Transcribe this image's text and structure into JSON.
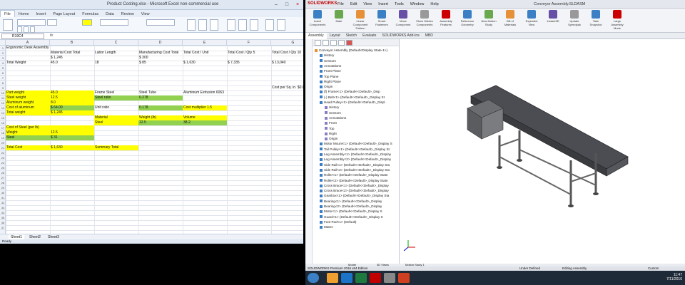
{
  "excel": {
    "title": "Product Costing.xlsx - Microsoft Excel non-commercial use",
    "tabs": [
      "File",
      "Home",
      "Insert",
      "Page Layout",
      "Formulas",
      "Data",
      "Review",
      "View"
    ],
    "name_box": "R19C4",
    "fx": "fx",
    "columns": [
      "",
      "A",
      "B",
      "C",
      "D",
      "E",
      "F",
      "G",
      "H"
    ],
    "rows": [
      "1",
      "2",
      "3",
      "4",
      "5",
      "6",
      "7",
      "8",
      "9",
      "10",
      "11",
      "12",
      "13",
      "14",
      "15",
      "16",
      "17",
      "18",
      "19",
      "20",
      "21",
      "22",
      "23",
      "24",
      "25",
      "26",
      "27",
      "28",
      "29",
      "30",
      "31",
      "32",
      "33",
      "34",
      "35",
      "36",
      "37"
    ],
    "cells": [
      {
        "r": 1,
        "c": 0,
        "t": "Ergonomic Desk Assembly",
        "fill": ""
      },
      {
        "r": 2,
        "c": 1,
        "t": "Material Cost Total",
        "fill": ""
      },
      {
        "r": 2,
        "c": 2,
        "t": "Labor Length",
        "fill": ""
      },
      {
        "r": 2,
        "c": 3,
        "t": "Manufacturing Cost Total",
        "fill": ""
      },
      {
        "r": 2,
        "c": 4,
        "t": "Total Cost / Unit",
        "fill": ""
      },
      {
        "r": 2,
        "c": 5,
        "t": "Total Cost / Qty 5",
        "fill": ""
      },
      {
        "r": 2,
        "c": 6,
        "t": "Total Cost / Qty 10",
        "fill": ""
      },
      {
        "r": 3,
        "c": 1,
        "t": "$ 1,245",
        "fill": ""
      },
      {
        "r": 3,
        "c": 3,
        "t": "$ 300",
        "fill": ""
      },
      {
        "r": 4,
        "c": 0,
        "t": "Total Weight",
        "fill": ""
      },
      {
        "r": 4,
        "c": 1,
        "t": "45.0",
        "fill": ""
      },
      {
        "r": 4,
        "c": 2,
        "t": "18",
        "fill": ""
      },
      {
        "r": 4,
        "c": 3,
        "t": "$ 85",
        "fill": ""
      },
      {
        "r": 4,
        "c": 4,
        "t": "$ 1,630",
        "fill": ""
      },
      {
        "r": 4,
        "c": 5,
        "t": "$ 7,335",
        "fill": ""
      },
      {
        "r": 4,
        "c": 6,
        "t": "$ 13,040",
        "fill": ""
      },
      {
        "r": 9,
        "c": 6,
        "t": "Cost per Sq. in. $0.05",
        "fill": ""
      },
      {
        "r": 10,
        "c": 0,
        "t": "Part weight",
        "fill": "y",
        "w": 124
      },
      {
        "r": 10,
        "c": 1,
        "t": "45.0",
        "fill": "y"
      },
      {
        "r": 10,
        "c": 2,
        "t": "Frame Steel",
        "fill": ""
      },
      {
        "r": 10,
        "c": 3,
        "t": "Steel Tube",
        "fill": ""
      },
      {
        "r": 10,
        "c": 4,
        "t": "Aluminum Extrusion 6063",
        "fill": ""
      },
      {
        "r": 11,
        "c": 0,
        "t": "Steel weight",
        "fill": "y",
        "w": 124
      },
      {
        "r": 11,
        "c": 1,
        "t": "12.5",
        "fill": "y"
      },
      {
        "r": 11,
        "c": 2,
        "t": "Steel ratio",
        "fill": "g"
      },
      {
        "r": 11,
        "c": 3,
        "t": "0.278",
        "fill": "g"
      },
      {
        "r": 12,
        "c": 0,
        "t": "Aluminum weight",
        "fill": "y",
        "w": 124
      },
      {
        "r": 12,
        "c": 1,
        "t": "8.0",
        "fill": "y"
      },
      {
        "r": 13,
        "c": 0,
        "t": "Cost of aluminum",
        "fill": "y",
        "w": 124
      },
      {
        "r": 13,
        "c": 1,
        "t": "$ 64.00",
        "fill": "g"
      },
      {
        "r": 13,
        "c": 2,
        "t": "Unit ratio",
        "fill": ""
      },
      {
        "r": 13,
        "c": 3,
        "t": "0.178",
        "fill": "g"
      },
      {
        "r": 13,
        "c": 4,
        "t": "Cost multiplier 1.5",
        "fill": "y"
      },
      {
        "r": 14,
        "c": 0,
        "t": "Total weight",
        "fill": "y",
        "w": 124
      },
      {
        "r": 14,
        "c": 1,
        "t": "$ 1,245",
        "fill": "y"
      },
      {
        "r": 15,
        "c": 2,
        "t": "Material",
        "fill": "y"
      },
      {
        "r": 15,
        "c": 3,
        "t": "Weight (lb)",
        "fill": "y"
      },
      {
        "r": 15,
        "c": 4,
        "t": "Volume",
        "fill": "y"
      },
      {
        "r": 16,
        "c": 2,
        "t": "Steel",
        "fill": "y"
      },
      {
        "r": 16,
        "c": 3,
        "t": "12.5",
        "fill": "g"
      },
      {
        "r": 16,
        "c": 4,
        "t": "38.2",
        "fill": "g"
      },
      {
        "r": 17,
        "c": 0,
        "t": "Cost of Steel (per lb)",
        "fill": "y",
        "w": 124
      },
      {
        "r": 18,
        "c": 0,
        "t": "Weight",
        "fill": "y",
        "w": 62
      },
      {
        "r": 18,
        "c": 1,
        "t": "12.5",
        "fill": "y"
      },
      {
        "r": 19,
        "c": 0,
        "t": "Steel",
        "fill": "g",
        "w": 62
      },
      {
        "r": 19,
        "c": 1,
        "t": "$ 31",
        "fill": "g"
      },
      {
        "r": 21,
        "c": 0,
        "t": "Total Cost",
        "fill": "y",
        "w": 124
      },
      {
        "r": 21,
        "c": 1,
        "t": "$ 1,630",
        "fill": "y"
      },
      {
        "r": 21,
        "c": 2,
        "t": "Summary Total",
        "fill": "y"
      }
    ],
    "sheets": [
      "Sheet1",
      "Sheet2",
      "Sheet3"
    ],
    "status": "Ready"
  },
  "solidworks": {
    "logo": "SOLIDWORKS",
    "menu": [
      "File",
      "Edit",
      "View",
      "Insert",
      "Tools",
      "Window",
      "Help"
    ],
    "doc_title": "Conveyor Assembly.SLDASM",
    "commands": [
      "Insert Components",
      "Mate",
      "Linear Component Pattern",
      "Smart Fasteners",
      "Move Component",
      "Show Hidden Components",
      "Assembly Features",
      "Reference Geometry",
      "New Motion Study",
      "Bill of Materials",
      "Exploded View",
      "Instant3D",
      "Update Speedpak",
      "Take Snapshot",
      "Large Assembly Mode"
    ],
    "tabs": [
      "Assembly",
      "Layout",
      "Sketch",
      "Evaluate",
      "SOLIDWORKS Add-Ins",
      "MBD"
    ],
    "tree": [
      {
        "lvl": 0,
        "t": "Conveyor Assembly (Default<Display State-1>)"
      },
      {
        "lvl": 1,
        "t": "History"
      },
      {
        "lvl": 1,
        "t": "Sensors"
      },
      {
        "lvl": 1,
        "t": "Annotations"
      },
      {
        "lvl": 1,
        "t": "Front Plane"
      },
      {
        "lvl": 1,
        "t": "Top Plane"
      },
      {
        "lvl": 1,
        "t": "Right Plane"
      },
      {
        "lvl": 1,
        "t": "Origin"
      },
      {
        "lvl": 1,
        "t": "(f) Frame<1> (Default<<Default>_Disp"
      },
      {
        "lvl": 1,
        "t": "(-) Belt<1> (Default<<Default>_Display St"
      },
      {
        "lvl": 1,
        "t": "Head Pulley<1> (Default<<Default>_Displ"
      },
      {
        "lvl": 2,
        "t": "History"
      },
      {
        "lvl": 2,
        "t": "Sensors"
      },
      {
        "lvl": 2,
        "t": "Annotations"
      },
      {
        "lvl": 2,
        "t": "Front"
      },
      {
        "lvl": 2,
        "t": "Top"
      },
      {
        "lvl": 2,
        "t": "Right"
      },
      {
        "lvl": 2,
        "t": "Origin"
      },
      {
        "lvl": 1,
        "t": "Motor Mount<1> (Default<<Default>_Display S"
      },
      {
        "lvl": 1,
        "t": "Tail Pulley<1> (Default<<Default>_Display St"
      },
      {
        "lvl": 1,
        "t": "Leg Assembly<1> (Default<<Default>_Display"
      },
      {
        "lvl": 1,
        "t": "Leg Assembly<2> (Default<<Default>_Display"
      },
      {
        "lvl": 1,
        "t": "Side Rail<1> (Default<<Default>_Display Sta"
      },
      {
        "lvl": 1,
        "t": "Side Rail<2> (Default<<Default>_Display Sta"
      },
      {
        "lvl": 1,
        "t": "Roller<1> (Default<<Default>_Display State"
      },
      {
        "lvl": 1,
        "t": "Roller<2> (Default<<Default>_Display State"
      },
      {
        "lvl": 1,
        "t": "Cross Brace<1> (Default<<Default>_Display"
      },
      {
        "lvl": 1,
        "t": "Cross Brace<2> (Default<<Default>_Display"
      },
      {
        "lvl": 1,
        "t": "Gearbox<1> (Default<<Default>_Display Sta"
      },
      {
        "lvl": 1,
        "t": "Bearing<1> (Default<<Default>_Display"
      },
      {
        "lvl": 1,
        "t": "Bearing<2> (Default<<Default>_Display"
      },
      {
        "lvl": 1,
        "t": "Motor<1> (Default<<Default>_Display S"
      },
      {
        "lvl": 1,
        "t": "Guard<1> (Default<<Default>_Display S"
      },
      {
        "lvl": 1,
        "t": "Foot Pad<1> (Default)"
      },
      {
        "lvl": 1,
        "t": "Mates"
      }
    ],
    "bottom_tabs": [
      "Model",
      "3D Views",
      "Motion Study 1"
    ],
    "status_left": "SOLIDWORKS Premium 2016 x64 Edition",
    "status_mid": "Under Defined",
    "status_edit": "Editing Assembly",
    "status_units": "Custom"
  },
  "taskbar": {
    "time": "11:47",
    "date": "7/11/2016",
    "colors": {
      "taskbar": "#1e2a38",
      "excel": "#1f7a3f",
      "solidworks": "#c00000"
    }
  }
}
